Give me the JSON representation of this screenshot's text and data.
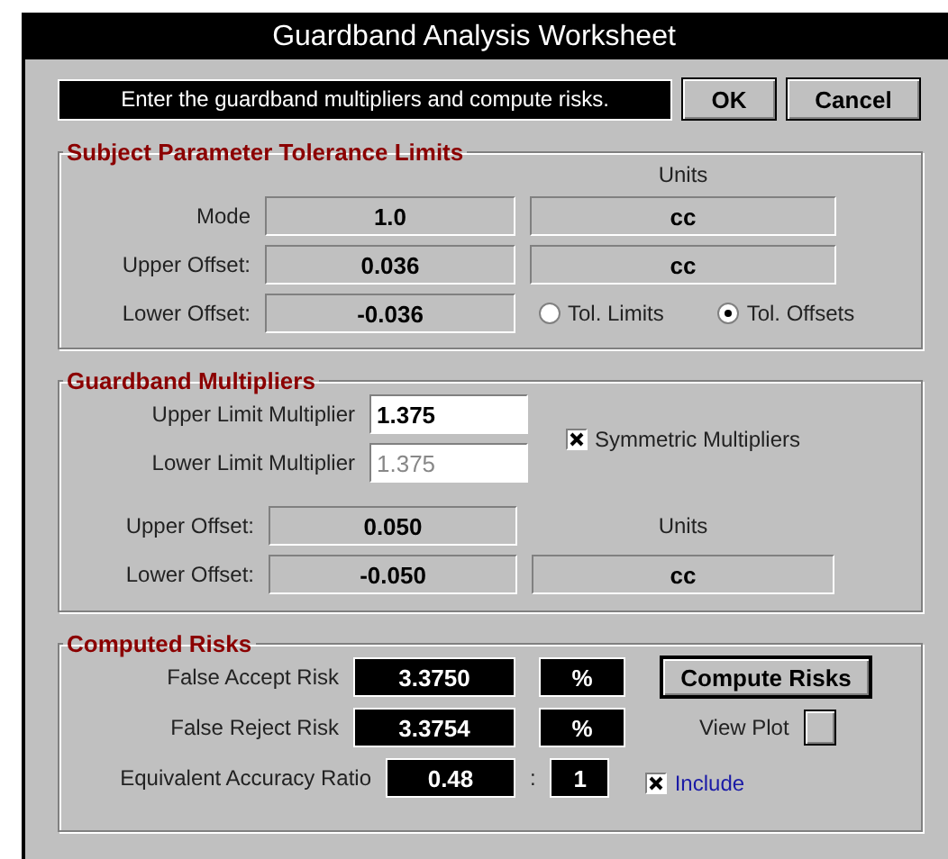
{
  "window": {
    "title": "Guardband Analysis Worksheet"
  },
  "message": "Enter the guardband multipliers and compute risks.",
  "buttons": [
    {
      "label": "OK"
    },
    {
      "label": "Cancel"
    }
  ],
  "tolerance": {
    "title": "Subject Parameter Tolerance Limits",
    "units_header": "Units",
    "rows": [
      {
        "label": "Mode",
        "value": "1.0",
        "units": "cc"
      },
      {
        "label": "Upper Offset:",
        "value": "0.036",
        "units": "cc"
      },
      {
        "label": "Lower Offset:",
        "value": "-0.036"
      }
    ],
    "radios": [
      {
        "label": "Tol. Limits",
        "selected": false
      },
      {
        "label": "Tol. Offsets",
        "selected": true
      }
    ]
  },
  "multipliers": {
    "title": "Guardband Multipliers",
    "inputs": [
      {
        "label": "Upper Limit Multiplier",
        "value": "1.375",
        "disabled": false
      },
      {
        "label": "Lower Limit Multiplier",
        "value": "1.375",
        "disabled": true
      }
    ],
    "symmetric": {
      "label": "Symmetric Multipliers",
      "checked": true
    },
    "offsets": [
      {
        "label": "Upper Offset:",
        "value": "0.050"
      },
      {
        "label": "Lower Offset:",
        "value": "-0.050"
      }
    ],
    "units_header": "Units",
    "units": "cc"
  },
  "risks": {
    "title": "Computed Risks",
    "rows": [
      {
        "label": "False Accept Risk",
        "value": "3.3750",
        "units": "%"
      },
      {
        "label": "False Reject Risk",
        "value": "3.3754",
        "units": "%"
      }
    ],
    "compute_button": "Compute Risks",
    "view_plot": {
      "label": "View Plot",
      "checked": false
    },
    "ratio": {
      "label": "Equivalent Accuracy Ratio",
      "value": "0.48",
      "separator": ":",
      "base": "1"
    },
    "include": {
      "label": "Include",
      "checked": true
    }
  }
}
